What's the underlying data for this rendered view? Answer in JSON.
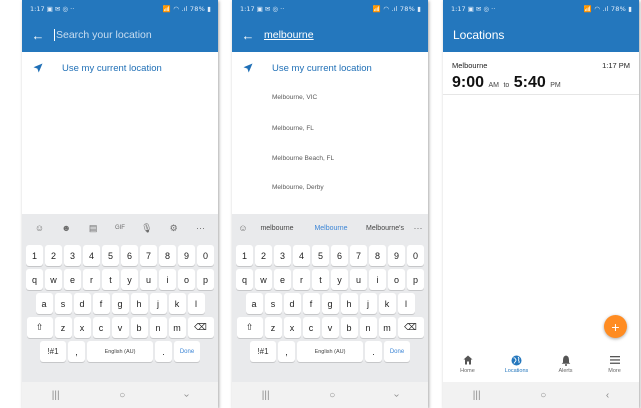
{
  "status": {
    "time": "1:17",
    "icons_left": "▣ ✉ ◎ ··",
    "right": "📶 ◠ .ıl 78% ▮"
  },
  "colors": {
    "primary": "#2477bd",
    "accent": "#ff8c22",
    "link": "#1f6fb6"
  },
  "screen1": {
    "search_placeholder": "Search your location",
    "current_location_label": "Use my current location",
    "keyboard": {
      "toolbar": [
        "☺",
        "☻",
        "▤",
        "GIF",
        "🎙",
        "⚙",
        "···"
      ],
      "rows": [
        [
          "1",
          "2",
          "3",
          "4",
          "5",
          "6",
          "7",
          "8",
          "9",
          "0"
        ],
        [
          "q",
          "w",
          "e",
          "r",
          "t",
          "y",
          "u",
          "i",
          "o",
          "p"
        ],
        [
          "a",
          "s",
          "d",
          "f",
          "g",
          "h",
          "j",
          "k",
          "l"
        ],
        [
          "⇧",
          "z",
          "x",
          "c",
          "v",
          "b",
          "n",
          "m",
          "⌫"
        ]
      ],
      "sym_label": "!#1",
      "comma_label": ",",
      "space_label": "English (AU)",
      "period_label": ".",
      "done_label": "Done"
    }
  },
  "screen2": {
    "search_value": "melbourne",
    "current_location_label": "Use my current location",
    "suggestions": [
      "Melbourne, VIC",
      "Melbourne, FL",
      "Melbourne Beach, FL",
      "Melbourne, Derby"
    ],
    "keyboard": {
      "predictions": [
        "melbourne",
        "Melbourne",
        "Melbourne's"
      ],
      "more_label": "···",
      "rows": [
        [
          "1",
          "2",
          "3",
          "4",
          "5",
          "6",
          "7",
          "8",
          "9",
          "0"
        ],
        [
          "q",
          "w",
          "e",
          "r",
          "t",
          "y",
          "u",
          "i",
          "o",
          "p"
        ],
        [
          "a",
          "s",
          "d",
          "f",
          "g",
          "h",
          "j",
          "k",
          "l"
        ],
        [
          "⇧",
          "z",
          "x",
          "c",
          "v",
          "b",
          "n",
          "m",
          "⌫"
        ]
      ],
      "sym_label": "!#1",
      "comma_label": ",",
      "space_label": "English (AU)",
      "period_label": ".",
      "done_label": "Done"
    }
  },
  "screen3": {
    "title": "Locations",
    "card": {
      "name": "Melbourne",
      "current_time": "1:17 PM",
      "start_time": "9:00",
      "start_ampm": "AM",
      "to_label": "to",
      "end_time": "5:40",
      "end_ampm": "PM"
    },
    "fab_label": "+",
    "bottom_nav": [
      {
        "label": "Home",
        "icon": "home-icon"
      },
      {
        "label": "Locations",
        "icon": "globe-icon",
        "active": true
      },
      {
        "label": "Alerts",
        "icon": "bell-icon"
      },
      {
        "label": "More",
        "icon": "menu-icon"
      }
    ]
  },
  "system_nav": {
    "recents": "|||",
    "home": "○",
    "back": "‹"
  }
}
